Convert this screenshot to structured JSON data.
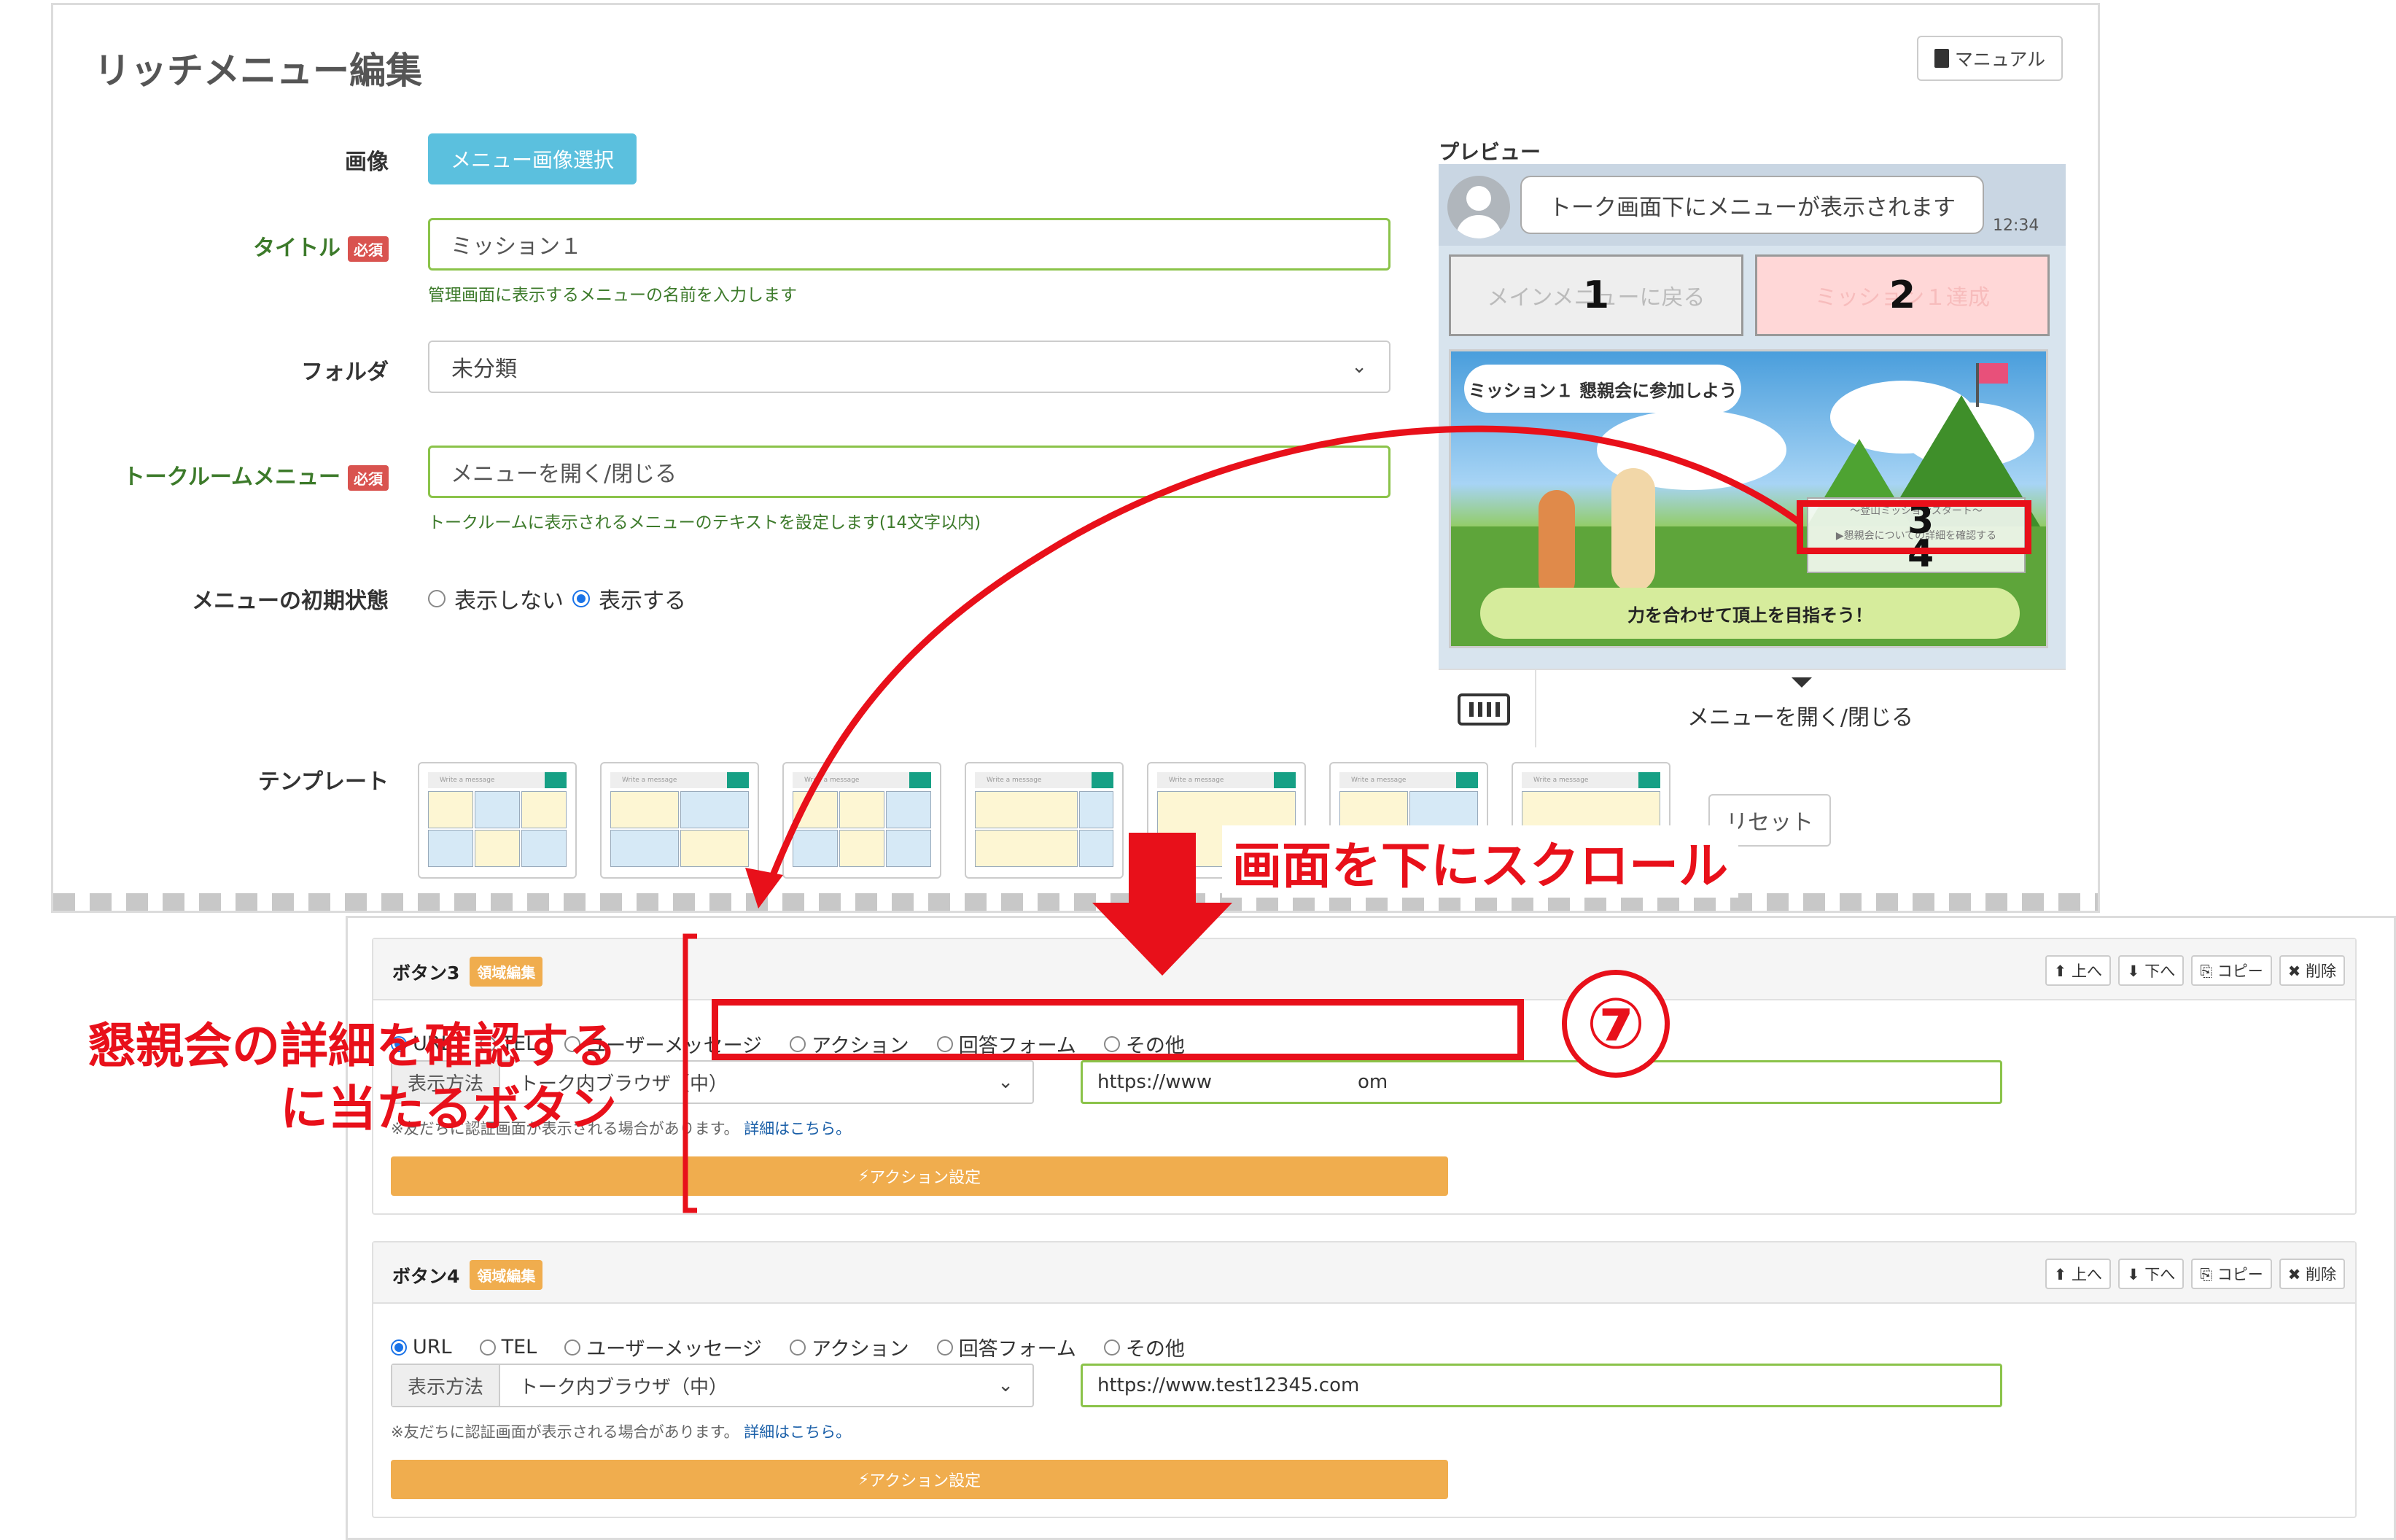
{
  "header": {
    "title": "リッチメニュー編集",
    "manual_label": "マニュアル"
  },
  "form": {
    "image_label": "画像",
    "image_button": "メニュー画像選択",
    "title_label": "タイトル",
    "required_badge": "必須",
    "title_value": "ミッション１",
    "title_help": "管理画面に表示するメニューの名前を入力します",
    "folder_label": "フォルダ",
    "folder_value": "未分類",
    "talkroom_label": "トークルームメニュー",
    "talkroom_value": "メニューを開く/閉じる",
    "talkroom_help": "トークルームに表示されるメニューのテキストを設定します(14文字以内)",
    "initial_label": "メニューの初期状態",
    "initial_options": [
      "表示しない",
      "表示する"
    ],
    "template_label": "テンプレート",
    "reset_label": "リセット"
  },
  "preview": {
    "label": "プレビュー",
    "bubble": "トーク画面下にメニューが表示されます",
    "time": "12:34",
    "cell1": "メインメニューに戻る",
    "cell2": "ミッション１達成",
    "banner_tag": "ミッション１ 懇親会に参加しよう",
    "banner_bar": "力を合わせて頂上を目指そう！",
    "mini_line1": "〜登山ミッションスタート〜",
    "mini_line2": "▶懇親会についての詳細を確認する",
    "num1": "1",
    "num2": "2",
    "num3": "3",
    "num4": "4",
    "menu_toggle": "メニューを開く/閉じる"
  },
  "template_thumb_text": "Write a message",
  "scroll_instruction": "画面を下にスクロール",
  "button3": {
    "title": "ボタン3",
    "badge": "領域編集",
    "controls": [
      "上へ",
      "下へ",
      "コピー",
      "削除"
    ],
    "radios": [
      "URL",
      "TEL",
      "ユーザーメッセージ",
      "アクション",
      "回答フォーム",
      "その他"
    ],
    "display_label": "表示方法",
    "display_value": "トーク内ブラウザ（中）",
    "url_value": "https://www",
    "url_tail": "om",
    "note": "※友だちに認証画面が表示される場合があります。",
    "note_link": "詳細はこちら。",
    "action": "アクション設定"
  },
  "button4": {
    "title": "ボタン4",
    "badge": "領域編集",
    "controls": [
      "上へ",
      "下へ",
      "コピー",
      "削除"
    ],
    "radios": [
      "URL",
      "TEL",
      "ユーザーメッセージ",
      "アクション",
      "回答フォーム",
      "その他"
    ],
    "display_label": "表示方法",
    "display_value": "トーク内ブラウザ（中）",
    "url_value": "https://www.test12345.com",
    "note": "※友だちに認証画面が表示される場合があります。",
    "note_link": "詳細はこちら。",
    "action": "アクション設定"
  },
  "annotation": {
    "left_line1": "懇親会の詳細を確認する",
    "left_line2": "に当たるボタン",
    "step": "⑦"
  },
  "colors": {
    "annotation_red": "#e8101a",
    "info_blue": "#5bc0de",
    "orange": "#f0ad4e",
    "green_label": "#3c7a2a"
  }
}
